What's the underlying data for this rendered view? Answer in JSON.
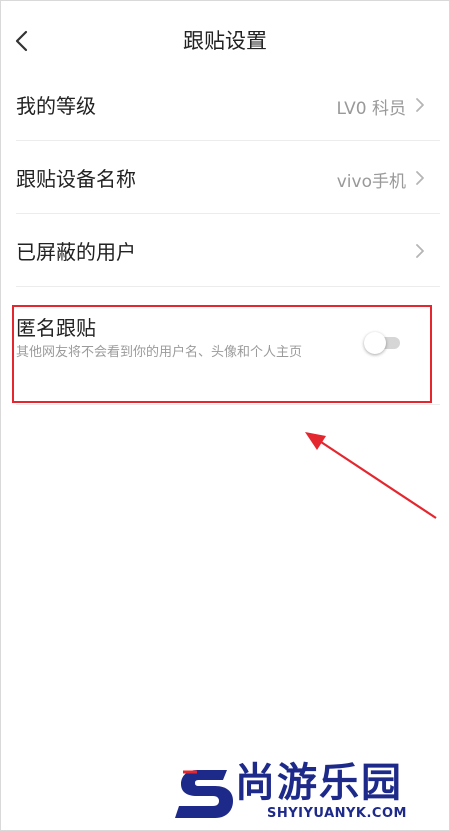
{
  "header": {
    "title": "跟贴设置",
    "back_icon": "chevron-left-icon"
  },
  "settings": {
    "level": {
      "label": "我的等级",
      "value": "LV0 科员"
    },
    "device": {
      "label": "跟贴设备名称",
      "value": "vivo手机"
    },
    "blocked": {
      "label": "已屏蔽的用户"
    },
    "anonymous": {
      "label": "匿名跟贴",
      "description": "其他网友将不会看到你的用户名、头像和个人主页",
      "enabled": false
    }
  },
  "watermark": {
    "name": "尚游乐园",
    "url": "SHYIYUANYK.COM"
  },
  "colors": {
    "annotation_red": "#e4262e",
    "watermark_blue": "#1e2a8a"
  }
}
